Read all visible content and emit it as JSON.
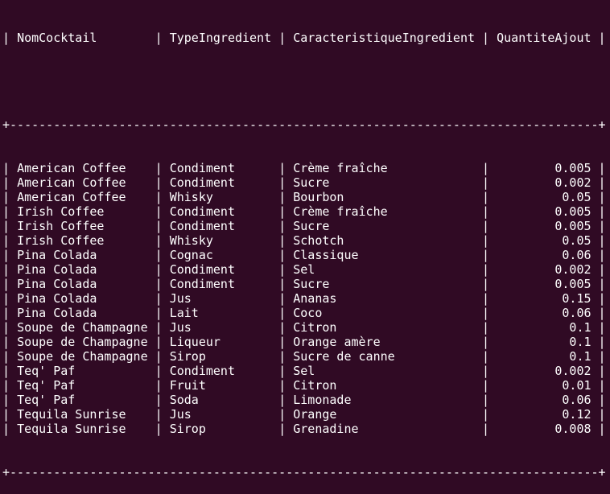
{
  "colors": {
    "background": "#300a24",
    "text": "#ffffff"
  },
  "table": {
    "columns": [
      "NomCocktail",
      "TypeIngredient",
      "CaracteristiqueIngredient",
      "QuantiteAjout"
    ],
    "rows": [
      [
        "American Coffee",
        "Condiment",
        "Crème fraîche",
        "0.005"
      ],
      [
        "American Coffee",
        "Condiment",
        "Sucre",
        "0.002"
      ],
      [
        "American Coffee",
        "Whisky",
        "Bourbon",
        "0.05"
      ],
      [
        "Irish Coffee",
        "Condiment",
        "Crème fraîche",
        "0.005"
      ],
      [
        "Irish Coffee",
        "Condiment",
        "Sucre",
        "0.005"
      ],
      [
        "Irish Coffee",
        "Whisky",
        "Schotch",
        "0.05"
      ],
      [
        "Pina Colada",
        "Cognac",
        "Classique",
        "0.06"
      ],
      [
        "Pina Colada",
        "Condiment",
        "Sel",
        "0.002"
      ],
      [
        "Pina Colada",
        "Condiment",
        "Sucre",
        "0.005"
      ],
      [
        "Pina Colada",
        "Jus",
        "Ananas",
        "0.15"
      ],
      [
        "Pina Colada",
        "Lait",
        "Coco",
        "0.06"
      ],
      [
        "Soupe de Champagne",
        "Jus",
        "Citron",
        "0.1"
      ],
      [
        "Soupe de Champagne",
        "Liqueur",
        "Orange amère",
        "0.1"
      ],
      [
        "Soupe de Champagne",
        "Sirop",
        "Sucre de canne",
        "0.1"
      ],
      [
        "Teq' Paf",
        "Condiment",
        "Sel",
        "0.002"
      ],
      [
        "Teq' Paf",
        "Fruit",
        "Citron",
        "0.01"
      ],
      [
        "Teq' Paf",
        "Soda",
        "Limonade",
        "0.06"
      ],
      [
        "Tequila Sunrise",
        "Jus",
        "Orange",
        "0.12"
      ],
      [
        "Tequila Sunrise",
        "Sirop",
        "Grenadine",
        "0.008"
      ]
    ]
  }
}
